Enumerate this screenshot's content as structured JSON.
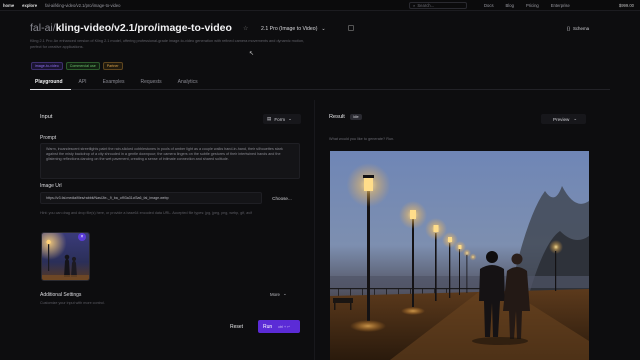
{
  "topbar": {
    "home": "home",
    "explore": "explore",
    "breadcrumb": "fal-ai/kling-video/v2.1/pro/image-to-video",
    "search_placeholder": "Search...",
    "nav": [
      "Docs",
      "Blog",
      "Pricing",
      "Enterprise"
    ],
    "credit": "$999.00"
  },
  "header": {
    "owner": "fal-ai/",
    "model": "kling-video/v2.1/pro/image-to-video",
    "version_select": "2.1 Pro (Image to Video)",
    "schema_label": "Schema",
    "description": "Kling 2.1 Pro: An enhanced version of Kling 2.1 model, offering professional-grade image-to-video generation with refined camera movements and dynamic motion, perfect for creative applications.",
    "badges": [
      "image-to-video",
      "Commercial use",
      "Partner"
    ]
  },
  "tabs": [
    "Playground",
    "API",
    "Examples",
    "Requests",
    "Analytics"
  ],
  "input": {
    "title": "Input",
    "form_label": "Form",
    "prompt_label": "Prompt",
    "prompt_value": "Warm, incandescent streetlights paint the rain-slicked cobblestones in pools of amber light as a couple walks hand-in-hand, their silhouettes stark against the misty backdrop of a city shrouded in a gentle downpour; the camera lingers on the subtle gestures of their intertwined hands and the glistening reflections dancing on the wet pavement, creating a sense of intimate connection and shared solitude.",
    "image_url_label": "Image Url",
    "image_url_value": "https://v3.fal.media/files/rabbit/NaslJIe-_9_ba_of93a31cf3a6_fal_image.webp",
    "choose_label": "Choose...",
    "hint": "Hint: you can drag and drop file(s) here, or provide a base64 encoded data URL. Accepted file types: jpg, jpeg, png, webp, gif, avif",
    "advanced_title": "Additional Settings",
    "advanced_hint": "Customize your input with more control.",
    "more_label": "More",
    "reset_label": "Reset",
    "run_label": "Run",
    "run_shortcut": "ctrl + ↵"
  },
  "result": {
    "title": "Result",
    "tag": "Idle",
    "preview_label": "Preview",
    "meta": "What would you like to generate? Run."
  },
  "colors": {
    "accent": "#5b2bd6",
    "background": "#0d0d0f"
  }
}
